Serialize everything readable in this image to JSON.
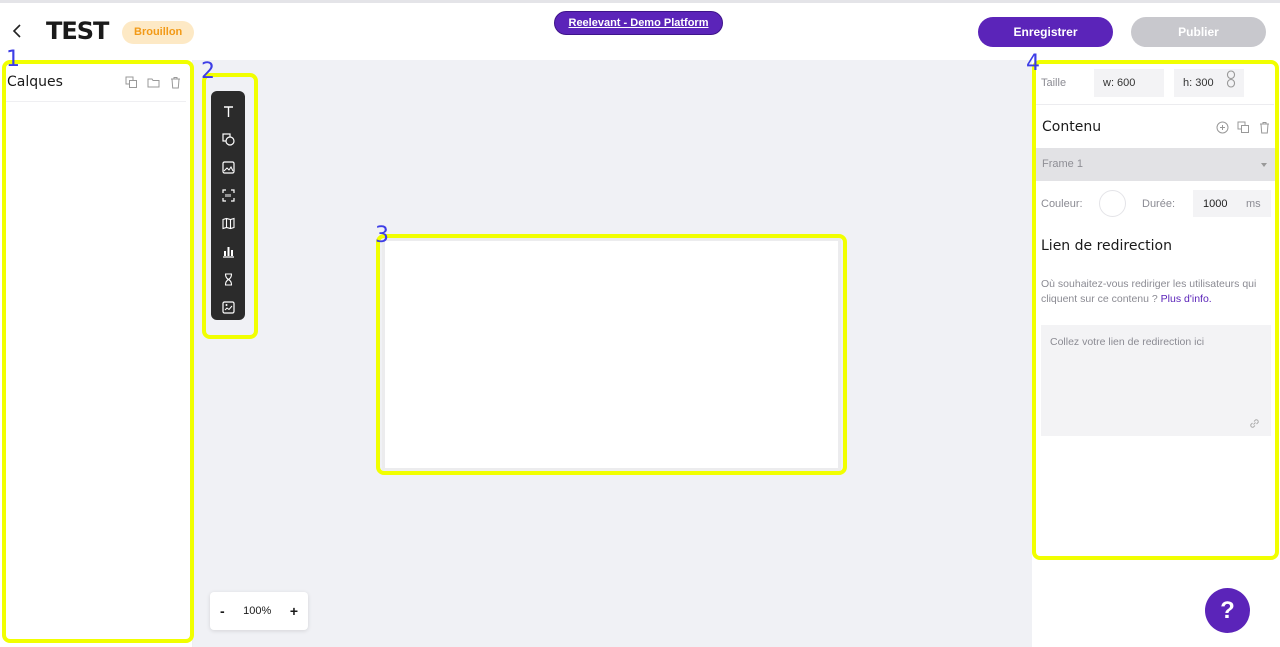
{
  "header": {
    "title": "TEST",
    "status": "Brouillon",
    "platform_link": "Reelevant - Demo Platform",
    "save_label": "Enregistrer",
    "publish_label": "Publier"
  },
  "layers": {
    "title": "Calques"
  },
  "toolbar": {
    "tools": [
      "text-icon",
      "shape-icon",
      "image-icon",
      "qr-code-icon",
      "map-icon",
      "chart-icon",
      "hourglass-icon",
      "gallery-icon"
    ]
  },
  "canvas": {
    "zoom": "100%",
    "zoom_out": "-",
    "zoom_in": "+"
  },
  "properties": {
    "size_label": "Taille",
    "width_value": "w: 600",
    "height_value": "h: 300",
    "content_title": "Contenu",
    "frame_selected": "Frame 1",
    "color_label": "Couleur:",
    "duration_label": "Durée:",
    "duration_value": "1000",
    "duration_unit": "ms",
    "redirect_title": "Lien de redirection",
    "redirect_desc": "Où souhaitez-vous rediriger les utilisateurs qui cliquent sur ce contenu ?",
    "redirect_more": "Plus d'info.",
    "redirect_placeholder": "Collez votre lien de redirection ici"
  },
  "help": {
    "label": "?"
  },
  "annotations": [
    "1",
    "2",
    "3",
    "4"
  ],
  "colors": {
    "accent": "#5b24b9",
    "badge_bg": "#fde9c5",
    "badge_text": "#f29a17",
    "highlight": "#f1ff00",
    "annotation_number": "#3d3de6"
  }
}
